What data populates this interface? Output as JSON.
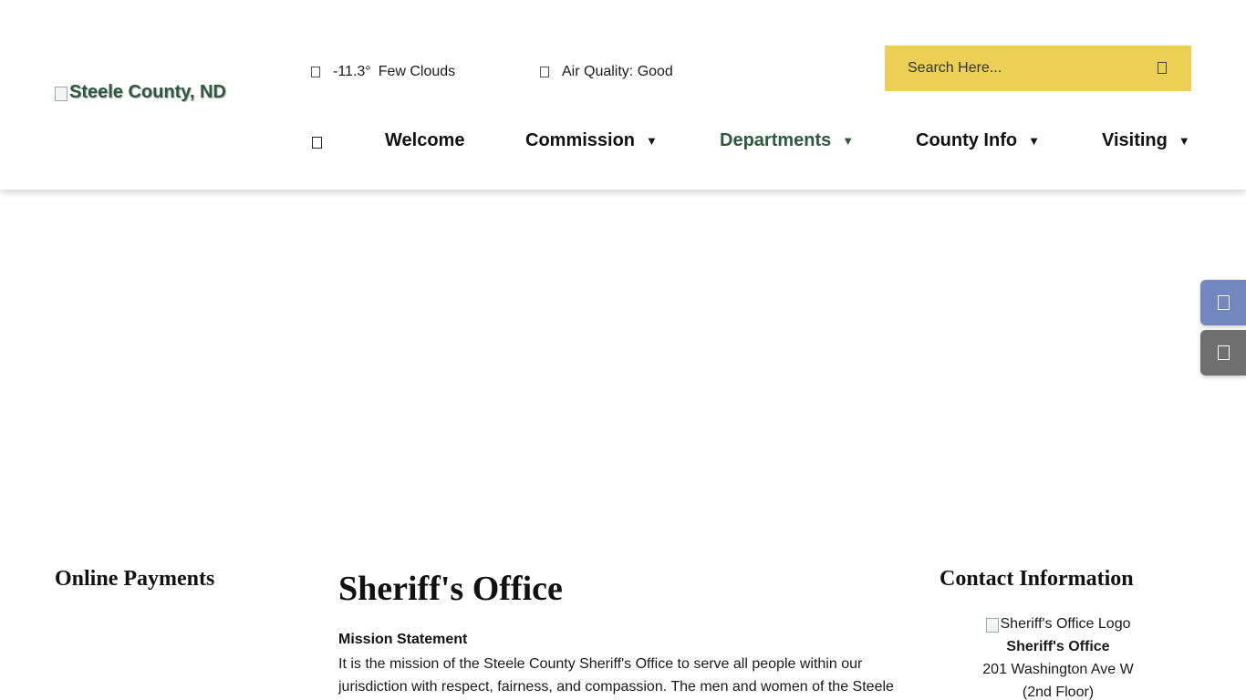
{
  "header": {
    "logo_alt": "Steele County, ND",
    "weather": {
      "temperature": "-11.3°",
      "condition": "Few Clouds"
    },
    "air_quality": "Air Quality: Good",
    "search": {
      "placeholder": "Search Here..."
    },
    "nav": {
      "items": [
        {
          "label": "Welcome"
        },
        {
          "label": "Commission",
          "arrow": "▼"
        },
        {
          "label": "Departments",
          "arrow": "▼"
        },
        {
          "label": "County Info",
          "arrow": "▼"
        },
        {
          "label": "Visiting",
          "arrow": "▼"
        }
      ]
    }
  },
  "content": {
    "left_title": "Online Payments",
    "page_title": "Sheriff's Office",
    "mission_heading": "Mission Statement",
    "mission_text": "It is the mission of the Steele County Sheriff's Office to serve all people within our jurisdiction with respect, fairness, and compassion. The men and women of the Steele",
    "contact": {
      "title": "Contact Information",
      "logo_alt": "Sheriff's Office Logo",
      "office_name": "Sheriff's Office",
      "address_line1": "201 Washington Ave W",
      "address_line2": "(2nd Floor)"
    }
  },
  "colors": {
    "accent_green": "#2d5a3a",
    "search_yellow": "#ecd053",
    "side_button_blue": "#7187be",
    "side_button_gray": "#6f6f6f"
  },
  "icons": {
    "weather": "cloud-icon",
    "air_quality": "leaf-icon",
    "search": "search-icon",
    "home": "home-icon",
    "side_a": "translate-icon",
    "side_b": "share-icon"
  }
}
